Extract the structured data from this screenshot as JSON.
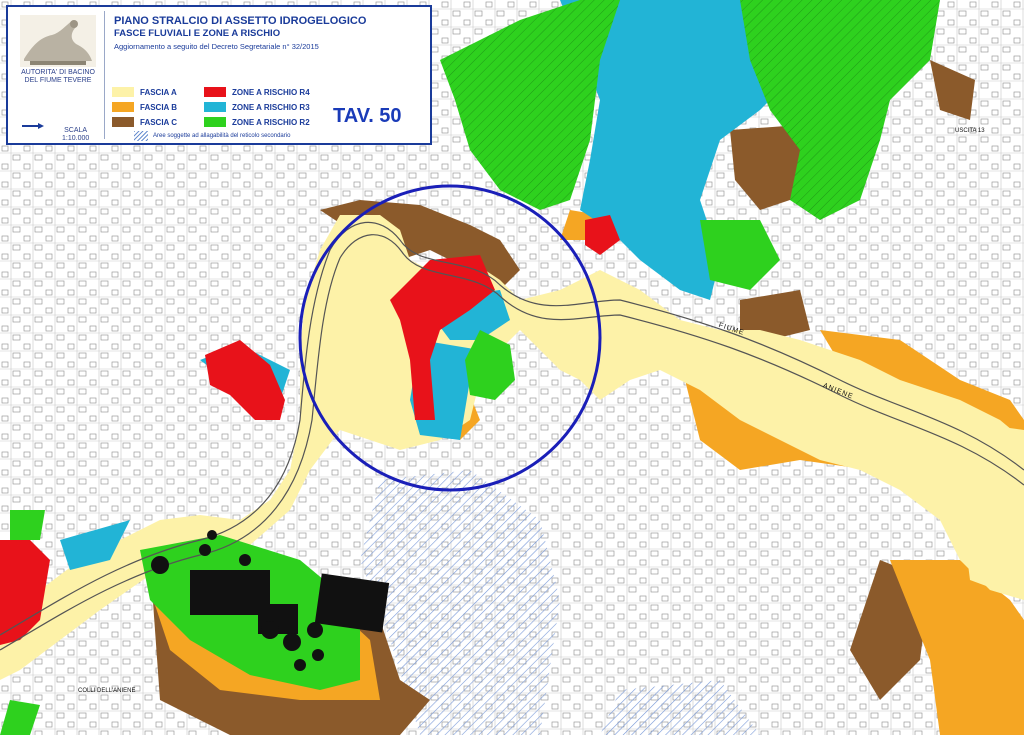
{
  "legend": {
    "title": "PIANO STRALCIO DI ASSETTO IDROGELOGICO",
    "subtitle": "FASCE FLUVIALI E ZONE A RISCHIO",
    "update_note": "Aggiornamento a seguito del Decreto Segretariale n° 32/2015",
    "authority": "AUTORITA' DI BACINO DEL FIUME TEVERE",
    "scale_label": "SCALA",
    "scale_value": "1:10.000",
    "sheet": "TAV. 50",
    "hatch_note": "Aree soggette ad allagabilità del reticolo secondario",
    "items": [
      {
        "label": "FASCIA A",
        "color": "#fdf2a8"
      },
      {
        "label": "FASCIA B",
        "color": "#f5a623"
      },
      {
        "label": "FASCIA C",
        "color": "#8b5a2b"
      },
      {
        "label": "ZONE A RISCHIO R4",
        "color": "#e8121a"
      },
      {
        "label": "ZONE A RISCHIO R3",
        "color": "#22b4d6"
      },
      {
        "label": "ZONE A RISCHIO R2",
        "color": "#2ed11e"
      }
    ]
  },
  "map_labels": {
    "river": "FIUME",
    "river2": "ANIENE",
    "hills": "COLLI DELL'ANIENE",
    "exit": "USCITA 13"
  },
  "colors": {
    "fascia_a": "#fdf2a8",
    "fascia_b": "#f5a623",
    "fascia_c": "#8b5a2b",
    "r4": "#e8121a",
    "r3": "#22b4d6",
    "r2": "#2ed11e",
    "circle": "#1a1fb8"
  }
}
